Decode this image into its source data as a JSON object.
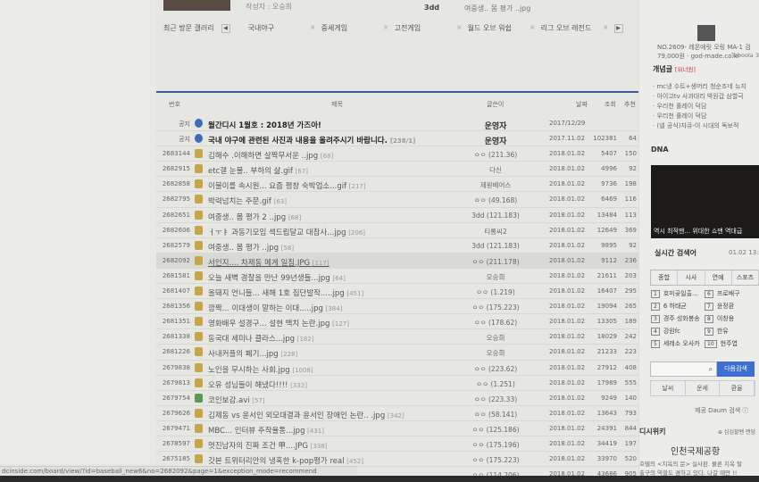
{
  "top": {
    "author": "작성자 : 오승희",
    "recent_writer": "3dd",
    "recent_title": "여중생.. 몸 평가 ..jpg",
    "recent_gallery_label": "최근 방문 갤러리",
    "recent_galleries": [
      "국내야구",
      "중세게임",
      "고전게임",
      "월드 오브 워쉽",
      "리그 오브 레전드"
    ]
  },
  "table": {
    "headers": {
      "num": "번호",
      "title": "제목",
      "writer": "글쓴이",
      "date": "날짜",
      "views": "조회",
      "recommend": "추천"
    },
    "rows": [
      {
        "num": "공지",
        "icon": "notice",
        "title": "월간디시 1월호 : 2018년 가즈아!",
        "comments": "",
        "writer": "운영자",
        "date": "2017/12/29",
        "views": "",
        "rec": "",
        "bold": true
      },
      {
        "num": "공지",
        "icon": "notice",
        "title": "국내 야구에 관련된 사진과 내용을 올려주시기 바랍니다.",
        "comments": "[238/1]",
        "writer": "운영자",
        "date": "2017.11.02",
        "views": "102381",
        "rec": "64",
        "bold": true
      },
      {
        "num": "2683144",
        "icon": "post",
        "title": "김해수 .이해하면 살짝무서운 ..jpg",
        "comments": "[68]",
        "writer": "ㅇㅇ (211.36)",
        "date": "2018.01.02",
        "views": "5407",
        "rec": "150"
      },
      {
        "num": "2682915",
        "icon": "post",
        "title": "etc갤 눈물.. 부하의 삶.gif",
        "comments": "[67]",
        "writer": "다신",
        "date": "2018.01.02",
        "views": "4996",
        "rec": "92"
      },
      {
        "num": "2682858",
        "icon": "post",
        "title": "이불이를 속시원... 요즘 평창 숙박업소...gif",
        "comments": "[217]",
        "writer": "제원베어스",
        "date": "2018.01.02",
        "views": "9736",
        "rec": "198"
      },
      {
        "num": "2682795",
        "icon": "post",
        "title": "박력넘치는 주문.gif",
        "comments": "[63]",
        "writer": "ㅇㅇ (49.168)",
        "date": "2018.01.02",
        "views": "6469",
        "rec": "116"
      },
      {
        "num": "2682651",
        "icon": "post",
        "title": "여중생.. 몸 평가 2 ..jpg",
        "comments": "[68]",
        "writer": "3dd (121.183)",
        "date": "2018.01.02",
        "views": "13484",
        "rec": "113"
      },
      {
        "num": "2682606",
        "icon": "post",
        "title": "ㅓㅜㅑ 과동기모임 섹드립달교 대참사...jpg",
        "comments": "[206]",
        "writer": "티롱씨2",
        "date": "2018.01.02",
        "views": "12649",
        "rec": "369"
      },
      {
        "num": "2682579",
        "icon": "post",
        "title": "여중생.. 몸 평가 ..jpg",
        "comments": "[58]",
        "writer": "3dd (121.183)",
        "date": "2018.01.02",
        "views": "9895",
        "rec": "92"
      },
      {
        "num": "2682092",
        "icon": "post",
        "title": "서인지.... 차제동 메게 일침.JPG",
        "comments": "[117]",
        "writer": "ㅇㅇ (211.178)",
        "date": "2018.01.02",
        "views": "9112",
        "rec": "236",
        "hl": true
      },
      {
        "num": "2681581",
        "icon": "post",
        "title": "오늘 새벽 경찰을 만난 99년생들...jpg",
        "comments": "[64]",
        "writer": "오승희",
        "date": "2018.01.02",
        "views": "21611",
        "rec": "203"
      },
      {
        "num": "2681407",
        "icon": "post",
        "title": "올돼지 언니들... 새해 1호 집단발작.....jpg",
        "comments": "[451]",
        "writer": "ㅇㅇ (1.219)",
        "date": "2018.01.02",
        "views": "16407",
        "rec": "295"
      },
      {
        "num": "2681356",
        "icon": "post",
        "title": "깜짝... 이대생이 말하는 이대.....jpg",
        "comments": "[384]",
        "writer": "ㅇㅇ (175.223)",
        "date": "2018.01.02",
        "views": "19094",
        "rec": "265"
      },
      {
        "num": "2681351",
        "icon": "post",
        "title": "영화배우 설경구... 설현 백치 논란.jpg",
        "comments": "[127]",
        "writer": "ㅇㅇ (178.62)",
        "date": "2018.01.02",
        "views": "13305",
        "rec": "189"
      },
      {
        "num": "2681338",
        "icon": "post",
        "title": "동국대 세미나 클라스...jpg",
        "comments": "[182]",
        "writer": "오승희",
        "date": "2018.01.02",
        "views": "18029",
        "rec": "242"
      },
      {
        "num": "2681226",
        "icon": "post",
        "title": "사내커플의 폐기...jpg",
        "comments": "[228]",
        "writer": "오승희",
        "date": "2018.01.02",
        "views": "21233",
        "rec": "223"
      },
      {
        "num": "2679838",
        "icon": "post",
        "title": "노인을 무시하는 사회.jpg",
        "comments": "[1008]",
        "writer": "ㅇㅇ (223.62)",
        "date": "2018.01.02",
        "views": "27912",
        "rec": "408"
      },
      {
        "num": "2679813",
        "icon": "post",
        "title": "오유 성님들이 해냈다!!!!",
        "comments": "[332]",
        "writer": "ㅇㅇ (1.251)",
        "date": "2018.01.02",
        "views": "17989",
        "rec": "555"
      },
      {
        "num": "2679754",
        "icon": "video",
        "title": "코인보감.avi",
        "comments": "[57]",
        "writer": "ㅇㅇ (223.33)",
        "date": "2018.01.02",
        "views": "9249",
        "rec": "140"
      },
      {
        "num": "2679626",
        "icon": "post",
        "title": "김제동 vs 윤서인 외모대결과 윤서인 장애인 논란.. .jpg",
        "comments": "[342]",
        "writer": "ㅇㅇ (58.141)",
        "date": "2018.01.02",
        "views": "13643",
        "rec": "793"
      },
      {
        "num": "2679471",
        "icon": "post",
        "title": "MBC... 인터뷰 주작율통...jpg",
        "comments": "[431]",
        "writer": "ㅇㅇ (125.186)",
        "date": "2018.01.02",
        "views": "24391",
        "rec": "844"
      },
      {
        "num": "2678597",
        "icon": "post",
        "title": "멋진남자의 진짜 조건 甲....JPG",
        "comments": "[338]",
        "writer": "ㅇㅇ (175.196)",
        "date": "2018.01.02",
        "views": "34419",
        "rec": "197"
      },
      {
        "num": "2675185",
        "icon": "post",
        "title": "갓본 트위터리안의 냉혹한 k-pop평가 real",
        "comments": "[452]",
        "writer": "ㅇㅇ (175.223)",
        "date": "2018.01.02",
        "views": "33970",
        "rec": "520"
      },
      {
        "num": "",
        "icon": "post",
        "title": "...jpg",
        "comments": "[490]",
        "writer": "ㅇㅇ (114.206)",
        "date": "2018.01.02",
        "views": "43686",
        "rec": "905"
      }
    ]
  },
  "side": {
    "ad_title": "NO.2609- 레몬에릿 오링 MA-1 검",
    "ad_price": "79,000원 · god-made.co.kr",
    "taboola": "Taboola 3",
    "concept_title": "개념글",
    "concept_sub": "[워너원]",
    "concept_items": [
      "· mc냉 수트+생머리 청순조네 뉴지",
      "· 아이고tv 사과대리 박원갑 삼할극",
      "· 우리천 훌레이 덕담",
      "· 우리천 훌레이 덕담",
      "· (넬 공식)자큐-이 시대의 독보적"
    ],
    "dna": "DNA",
    "video_caption": "역시 최적맨... 위대한 쇼맨 역대급",
    "realtime_title": "실시간 검색어",
    "realtime_time": "01.02 13:1",
    "tabs": [
      "종합",
      "시사",
      "연예",
      "스포츠"
    ],
    "keywords": [
      "호미곶일출...",
      "6 하태균",
      "경주 성화봉송",
      "강원fc",
      "세레소 오사카",
      "프로배구",
      "윤정환",
      "이창용",
      "한유",
      "현주엽"
    ],
    "search_btn": "다음검색",
    "mini": [
      "날씨",
      "운세",
      "환율"
    ],
    "provider": "제공 Daum 검색 ⓘ",
    "wiki_title": "디시위키",
    "wiki_link": "⊕ 심심할땐 랜덤",
    "wiki_article": "인천국제공항",
    "wiki_text1": "호텔의 <지옥의 문> 실사판. 물론 지옥 탈",
    "wiki_text2": "출구의 역할도 겸하고 있다. 나갈 때만 !!"
  },
  "status_url": "dcinside.com/board/view/?id=baseball_new6&no=2682092&page=1&exception_mode=recommend"
}
